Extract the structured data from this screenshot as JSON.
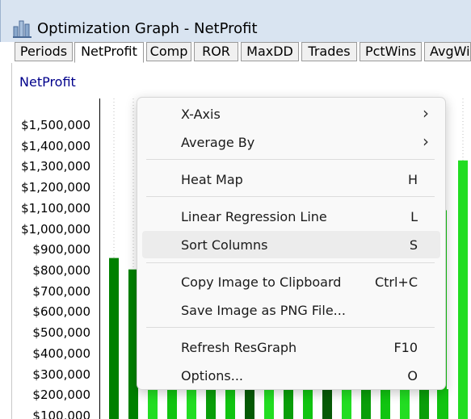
{
  "window": {
    "title": "Optimization Graph - NetProfit"
  },
  "tabs": [
    {
      "label": "Periods",
      "active": false
    },
    {
      "label": "NetProfit",
      "active": true
    },
    {
      "label": "Comp",
      "active": false
    },
    {
      "label": "ROR",
      "active": false
    },
    {
      "label": "MaxDD",
      "active": false
    },
    {
      "label": "Trades",
      "active": false
    },
    {
      "label": "PctWins",
      "active": false
    },
    {
      "label": "AvgWi",
      "active": false
    }
  ],
  "chart_data": {
    "type": "bar",
    "title": "NetProfit",
    "ylim": [
      100000,
      1500000
    ],
    "yticks": [
      "$1,500,000",
      "$1,400,000",
      "$1,300,000",
      "$1,200,000",
      "$1,100,000",
      "$1,000,000",
      "$900,000",
      "$800,000",
      "$700,000",
      "$600,000",
      "$500,000",
      "$400,000",
      "$300,000",
      "$200,000",
      "$100,000"
    ],
    "visible_bars": [
      {
        "value": 860000,
        "color": "#008000"
      },
      {
        "value": 805000,
        "color": "#008000"
      },
      {
        "value": 1090000,
        "color": "#11c411"
      },
      {
        "value": 1330000,
        "color": "#22dd22"
      }
    ],
    "grid": true
  },
  "context_menu": {
    "items": [
      {
        "label": "X-Axis",
        "shortcut": "",
        "submenu": true,
        "highlighted": false
      },
      {
        "label": "Average By",
        "shortcut": "",
        "submenu": true,
        "highlighted": false
      },
      {
        "label": "Heat Map",
        "shortcut": "H",
        "submenu": false,
        "highlighted": false
      },
      {
        "label": "Linear Regression Line",
        "shortcut": "L",
        "submenu": false,
        "highlighted": false
      },
      {
        "label": "Sort Columns",
        "shortcut": "S",
        "submenu": false,
        "highlighted": true
      },
      {
        "label": "Copy Image to Clipboard",
        "shortcut": "Ctrl+C",
        "submenu": false,
        "highlighted": false
      },
      {
        "label": "Save Image as PNG File...",
        "shortcut": "",
        "submenu": false,
        "highlighted": false
      },
      {
        "label": "Refresh ResGraph",
        "shortcut": "F10",
        "submenu": false,
        "highlighted": false
      },
      {
        "label": "Options...",
        "shortcut": "O",
        "submenu": false,
        "highlighted": false
      }
    ],
    "chevron_glyph": "›"
  },
  "colors": {
    "title_bar": "#d9e4f1",
    "chart_title": "#00008b",
    "menu_highlight": "#ececec"
  },
  "icons": {
    "app": "bar-chart-icon"
  }
}
